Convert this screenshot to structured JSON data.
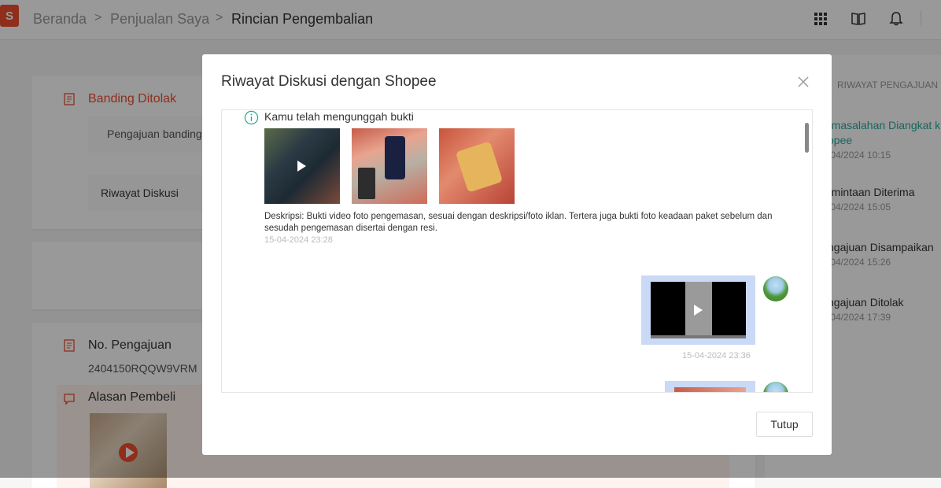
{
  "header": {
    "logo_text": "S",
    "breadcrumb": [
      "Beranda",
      "Penjualan Saya",
      "Rincian Pengembalian"
    ],
    "separator": ">",
    "icons": [
      "apps-grid-icon",
      "book-icon",
      "bell-icon"
    ]
  },
  "background": {
    "appeal_status": "Banding Ditolak",
    "appeal_text": "Pengajuan banding",
    "discussion_link": "Riwayat Diskusi",
    "request_no_label": "No. Pengajuan",
    "request_no_value": "2404150RQQW9VRM",
    "buyer_reason_label": "Alasan Pembeli",
    "history_heading": "RIWAYAT PENGAJUAN",
    "timeline": [
      {
        "title": "rmasalahan Diangkat k",
        "title2": "opee",
        "time": "/04/2024 10:15"
      },
      {
        "title": "rmintaan Diterima",
        "time": "/04/2024 15:05"
      },
      {
        "title": "ngajuan Disampaikan",
        "time": "/04/2024 15:26"
      },
      {
        "title": "ngajuan Ditolak",
        "time": "/04/2024 17:39"
      }
    ]
  },
  "modal": {
    "title": "Riwayat Diskusi dengan Shopee",
    "notice": "Kamu telah mengunggah bukti",
    "description": "Deskripsi: Bukti video foto pengemasan, sesuai dengan deskripsi/foto iklan. Tertera juga bukti foto keadaan paket sebelum dan sesudah pengemasan disertai dengan resi.",
    "timestamp_1": "15-04-2024 23:28",
    "timestamp_2": "15-04-2024 23:36",
    "close_button": "Tutup"
  },
  "colors": {
    "brand": "#ee4d2d",
    "accent": "#26aa99",
    "message_bubble": "#c9d9f6"
  }
}
